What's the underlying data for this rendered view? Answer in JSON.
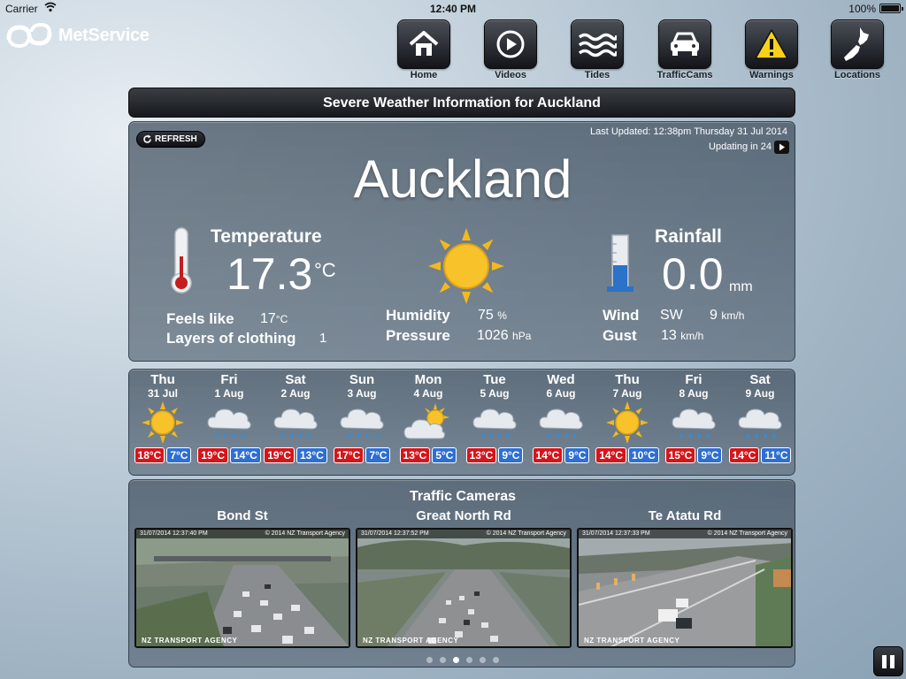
{
  "status_bar": {
    "carrier": "Carrier",
    "time": "12:40 PM",
    "battery": "100%"
  },
  "brand": {
    "name": "MetService"
  },
  "nav": [
    {
      "label": "Home",
      "icon": "home-icon"
    },
    {
      "label": "Videos",
      "icon": "play-icon"
    },
    {
      "label": "Tides",
      "icon": "waves-icon"
    },
    {
      "label": "TrafficCams",
      "icon": "car-icon"
    },
    {
      "label": "Warnings",
      "icon": "warning-icon"
    },
    {
      "label": "Locations",
      "icon": "nz-map-icon"
    }
  ],
  "severe_banner": "Severe Weather Information for Auckland",
  "current": {
    "refresh_label": "REFRESH",
    "last_updated": "Last Updated: 12:38pm Thursday 31 Jul 2014",
    "updating": "Updating in 24",
    "city": "Auckland",
    "temperature_title": "Temperature",
    "temperature": "17.3",
    "temperature_unit": "°C",
    "feels_like_label": "Feels like",
    "feels_like_value": "17",
    "feels_like_unit": "°C",
    "layers_label": "Layers of clothing",
    "layers_value": "1",
    "humidity_label": "Humidity",
    "humidity_value": "75",
    "humidity_unit": "%",
    "pressure_label": "Pressure",
    "pressure_value": "1026",
    "pressure_unit": "hPa",
    "rainfall_title": "Rainfall",
    "rainfall": "0.0",
    "rainfall_unit": "mm",
    "wind_label": "Wind",
    "wind_dir": "SW",
    "wind_value": "9",
    "wind_unit": "km/h",
    "gust_label": "Gust",
    "gust_value": "13",
    "gust_unit": "km/h",
    "condition_icon": "sun-icon"
  },
  "forecast": [
    {
      "day": "Thu",
      "date": "31 Jul",
      "icon": "sun",
      "max": "18°C",
      "min": "7°C"
    },
    {
      "day": "Fri",
      "date": "1 Aug",
      "icon": "rain",
      "max": "19°C",
      "min": "14°C"
    },
    {
      "day": "Sat",
      "date": "2 Aug",
      "icon": "rain",
      "max": "19°C",
      "min": "13°C"
    },
    {
      "day": "Sun",
      "date": "3 Aug",
      "icon": "rain",
      "max": "17°C",
      "min": "7°C"
    },
    {
      "day": "Mon",
      "date": "4 Aug",
      "icon": "partly-cloudy",
      "max": "13°C",
      "min": "5°C"
    },
    {
      "day": "Tue",
      "date": "5 Aug",
      "icon": "rain",
      "max": "13°C",
      "min": "9°C"
    },
    {
      "day": "Wed",
      "date": "6 Aug",
      "icon": "rain",
      "max": "14°C",
      "min": "9°C"
    },
    {
      "day": "Thu",
      "date": "7 Aug",
      "icon": "sun",
      "max": "14°C",
      "min": "10°C"
    },
    {
      "day": "Fri",
      "date": "8 Aug",
      "icon": "rain",
      "max": "15°C",
      "min": "9°C"
    },
    {
      "day": "Sat",
      "date": "9 Aug",
      "icon": "rain",
      "max": "14°C",
      "min": "11°C"
    }
  ],
  "traffic": {
    "title": "Traffic Cameras",
    "cameras": [
      {
        "name": "Bond St",
        "timestamp": "31/07/2014 12:37:40 PM",
        "credit": "© 2014 NZ Transport Agency",
        "agency": "NZ TRANSPORT AGENCY"
      },
      {
        "name": "Great North Rd",
        "timestamp": "31/07/2014 12:37:52 PM",
        "credit": "© 2014 NZ Transport Agency",
        "agency": "NZ TRANSPORT AGENCY"
      },
      {
        "name": "Te Atatu Rd",
        "timestamp": "31/07/2014 12:37:33 PM",
        "credit": "© 2014 NZ Transport Agency",
        "agency": "NZ TRANSPORT AGENCY"
      }
    ],
    "page_count": 6,
    "active_page": 3
  },
  "colors": {
    "max_temp": "#d6151b",
    "min_temp": "#2d6fd4",
    "sun": "#f5b81c"
  }
}
